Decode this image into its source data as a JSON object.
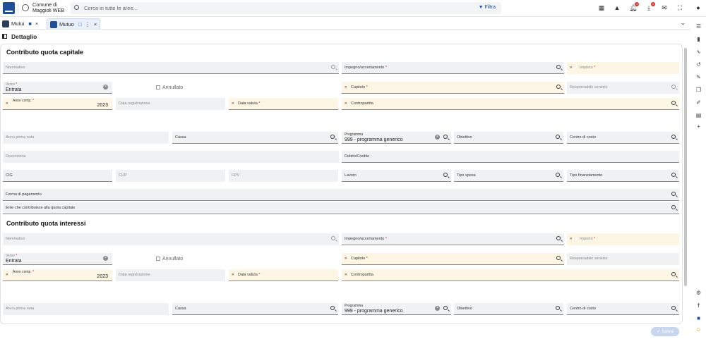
{
  "topbar": {
    "org_name": "Comune di\nMaggioli WEB",
    "search_placeholder": "Cerca in tutte le aree...",
    "filter_label": "Filtra",
    "notifications_badge": "4",
    "downloads_badge": "1"
  },
  "tabs": [
    {
      "label": "Mutui"
    },
    {
      "label": "Mutuo"
    }
  ],
  "page_title": "Dettaglio",
  "sections": {
    "capitale": {
      "title": "Contributo quota capitale",
      "nominativo": "Nominativo",
      "impegno": "Impegno/accertamento",
      "importo": "Importo",
      "verso_label": "Verso",
      "verso_value": "Entrata",
      "annullato": "Annullato",
      "capitolo": "Capitolo",
      "responsabile": "Responsabile servizio",
      "anno_comp": "Anno comp.",
      "anno_comp_value": "2023",
      "data_registrazione": "Data registrazione",
      "data_valuta": "Data valuta",
      "contropartita": "Contropartita",
      "anno_prima_nota": "Anno prima nota",
      "cassa": "Cassa",
      "programma_label": "Programma",
      "programma_value": "999 - programma generico",
      "obiettivo": "Obiettivo",
      "centro_costo": "Centro di costo",
      "descrizione": "Descrizione",
      "debito_credito": "Debito/Credito",
      "cig": "CIG",
      "cup": "CUP",
      "cpv": "CPV",
      "lavoro": "Lavoro",
      "tipo_spesa": "Tipo spesa",
      "tipo_finanziamento": "Tipo finanziamento",
      "forma_pagamento": "Forma di pagamento",
      "ente": "Ente che contribuisce alla quota capitale"
    },
    "interessi": {
      "title": "Contributo quota interessi",
      "nominativo": "Nominativo",
      "impegno": "Impegno/accertamento",
      "importo": "Importo",
      "verso_label": "Verso",
      "verso_value": "Entrata",
      "annullato": "Annullato",
      "capitolo": "Capitolo",
      "responsabile": "Responsabile servizio",
      "anno_comp": "Anno comp.",
      "anno_comp_value": "2023",
      "data_registrazione": "Data registrazione",
      "data_valuta": "Data valuta",
      "contropartita": "Contropartita",
      "anno_prima_nota": "Anno prima nota",
      "cassa": "Cassa",
      "programma_label": "Programma",
      "programma_value": "999 - programma generico",
      "obiettivo": "Obiettivo",
      "centro_costo": "Centro di costo"
    }
  },
  "required_marker": "*",
  "save_label": "Salva"
}
